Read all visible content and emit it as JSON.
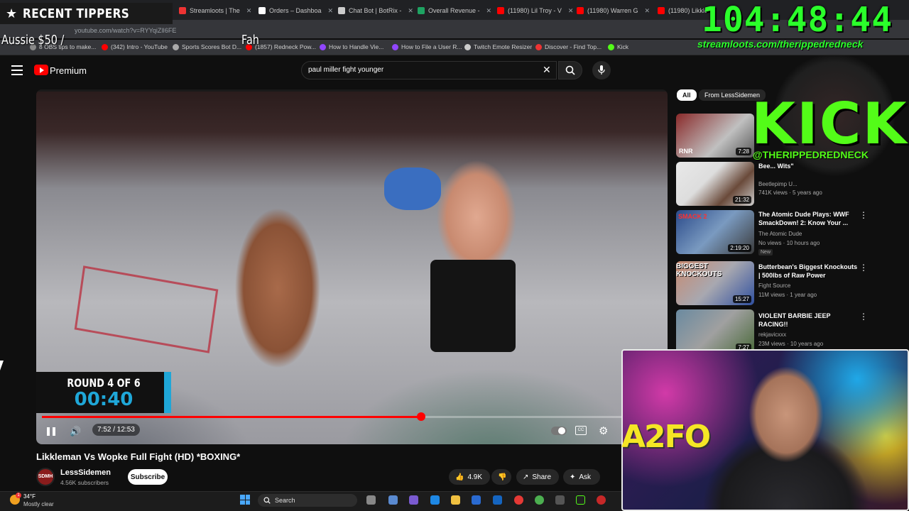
{
  "browser": {
    "tabs": [
      {
        "title": "Streamloots | The",
        "color": "#e33"
      },
      {
        "title": "Orders – Dashboa",
        "color": "#fff"
      },
      {
        "title": "Chat Bot | BotRix -",
        "color": "#ccc"
      },
      {
        "title": "Overall Revenue -",
        "color": "#1ea362"
      },
      {
        "title": "(11980) Lil Troy - V",
        "color": "#ff0000"
      },
      {
        "title": "(11980) Warren G",
        "color": "#ff0000"
      },
      {
        "title": "(11980) Likkle",
        "color": "#ff0000"
      }
    ],
    "url": "youtube.com/watch?v=RYYqiZlI6FE",
    "bookmarks": [
      {
        "label": "8 OBS tips to make...",
        "color": "#888"
      },
      {
        "label": "(342) Intro - YouTube",
        "color": "#ff0000"
      },
      {
        "label": "Sports Scores Bot D...",
        "color": "#aaa"
      },
      {
        "label": "(1857) Redneck Pow...",
        "color": "#ff0000"
      },
      {
        "label": "How to Handle Vie...",
        "color": "#9146ff"
      },
      {
        "label": "How to File a User R...",
        "color": "#9146ff"
      },
      {
        "label": "Twitch Emote Resizer",
        "color": "#ccc"
      },
      {
        "label": "Discover - Find Top...",
        "color": "#e33"
      },
      {
        "label": "Kick",
        "color": "#53fc18"
      }
    ]
  },
  "overlay": {
    "tippers_title": "RECENT TIPPERS",
    "tipper_a": "Aussie $50 /",
    "tipper_b": "Fah",
    "timer": "104:48:44",
    "stream_url": "streamloots.com/therippedredneck",
    "kick_logo": "KICK",
    "kick_handle": "@THERIPPEDREDNECK"
  },
  "youtube": {
    "brand": "Premium",
    "search_query": "paul miller fight younger",
    "video": {
      "round_label": "ROUND 4 OF 6",
      "round_time": "00:40",
      "time_display": "7:52 / 12:53",
      "progress": 0.612,
      "title": "Likkleman Vs Wopke Full Fight (HD) *BOXING*"
    },
    "channel": {
      "avatar_text": "SDMH",
      "name": "LessSidemen",
      "subscribers": "4.56K subscribers",
      "subscribe_label": "Subscribe"
    },
    "actions": {
      "likes": "4.9K",
      "share": "Share",
      "ask": "Ask"
    },
    "filter_chips": [
      "All",
      "From LessSidemen"
    ],
    "recommendations": [
      {
        "title": "",
        "channel": "",
        "meta": "",
        "duration": "7:28",
        "thumb_text": "RNR",
        "new": ""
      },
      {
        "title": "Bee... Wits\"",
        "channel": "Beetlepimp U...",
        "meta": "741K views · 5 years ago",
        "duration": "21:32",
        "thumb_text": "",
        "new": ""
      },
      {
        "title": "The Atomic Dude Plays: WWF SmackDown! 2: Know Your ...",
        "channel": "The Atomic Dude",
        "meta": "No views · 10 hours ago",
        "duration": "2:19:20",
        "thumb_text": "SMACK 2",
        "new": "New"
      },
      {
        "title": "Butterbean's Biggest Knockouts | 500lbs of Raw Power",
        "channel": "Fight Source",
        "meta": "11M views · 1 year ago",
        "duration": "15:27",
        "thumb_text": "BIGGEST KNOCKOUTS",
        "new": ""
      },
      {
        "title": "VIOLENT BARBIE JEEP RACING!!",
        "channel": "rekjavicxxx",
        "meta": "23M views · 10 years ago",
        "duration": "7:27",
        "thumb_text": "",
        "new": ""
      }
    ]
  },
  "webcam": {
    "sign_text": "A2FO"
  },
  "taskbar": {
    "weather_temp": "34°F",
    "weather_desc": "Mostly clear",
    "weather_badge": "1",
    "search_label": "Search"
  },
  "colors": {
    "accent_red": "#ff0000",
    "kick_green": "#53fc18",
    "timer_green": "#2bff2b",
    "round_blue": "#1fa7d8"
  }
}
